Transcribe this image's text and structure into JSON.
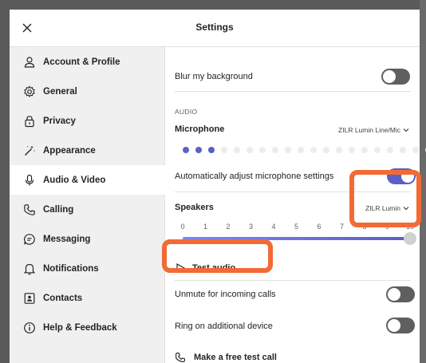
{
  "header": {
    "title": "Settings"
  },
  "sidebar": {
    "items": [
      {
        "label": "Account & Profile",
        "icon": "person-icon"
      },
      {
        "label": "General",
        "icon": "gear-icon"
      },
      {
        "label": "Privacy",
        "icon": "lock-icon"
      },
      {
        "label": "Appearance",
        "icon": "magic-wand-icon"
      },
      {
        "label": "Audio & Video",
        "icon": "microphone-icon",
        "active": true
      },
      {
        "label": "Calling",
        "icon": "phone-icon"
      },
      {
        "label": "Messaging",
        "icon": "chat-icon"
      },
      {
        "label": "Notifications",
        "icon": "bell-icon"
      },
      {
        "label": "Contacts",
        "icon": "contacts-icon"
      },
      {
        "label": "Help & Feedback",
        "icon": "info-icon"
      }
    ]
  },
  "content": {
    "blur_label": "Blur my background",
    "blur_on": false,
    "audio_section": "AUDIO",
    "microphone_label": "Microphone",
    "microphone_device": "ZILR Lumin Line/Mic",
    "mic_level_dots": 20,
    "mic_level_lit": 3,
    "auto_adjust_label": "Automatically adjust microphone settings",
    "auto_adjust_on": true,
    "speakers_label": "Speakers",
    "speakers_device": "ZILR Lumin",
    "speaker_ticks": [
      "0",
      "1",
      "2",
      "3",
      "4",
      "5",
      "6",
      "7",
      "8",
      "9",
      "10"
    ],
    "speaker_volume": 10,
    "test_audio_label": "Test audio",
    "unmute_label": "Unmute for incoming calls",
    "unmute_on": false,
    "ring_label": "Ring on additional device",
    "ring_on": false,
    "test_call_label": "Make a free test call"
  },
  "colors": {
    "accent": "#5b5fc7",
    "highlight": "#f26a35",
    "toggle_off": "#5f5f5f"
  }
}
